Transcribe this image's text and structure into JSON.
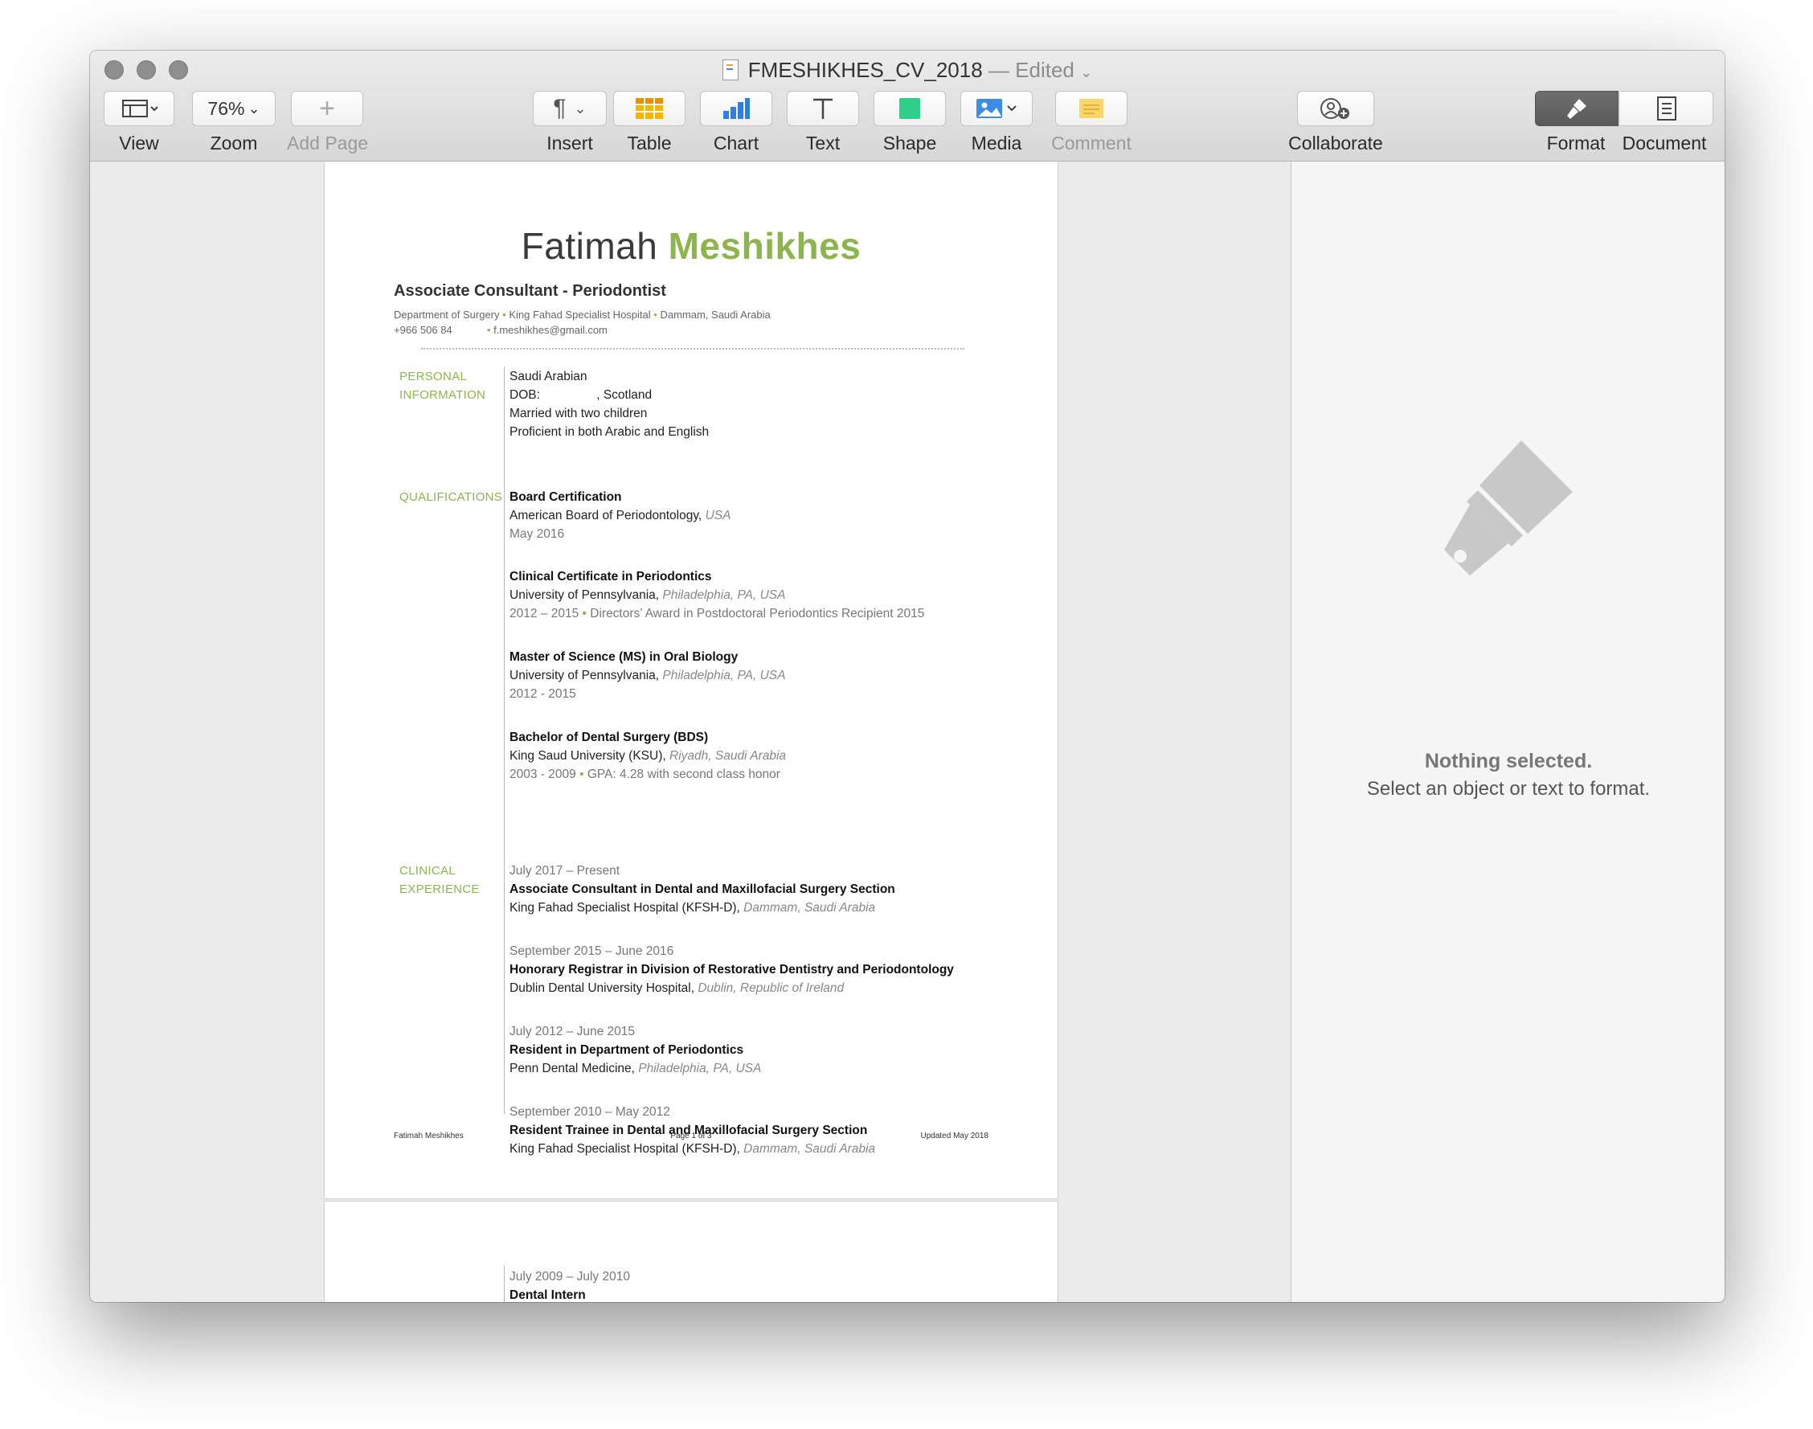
{
  "window": {
    "title": "FMESHIKHES_CV_2018",
    "title_separator": "—",
    "edited": "Edited"
  },
  "toolbar": {
    "view": "View",
    "zoom_value": "76%",
    "zoom": "Zoom",
    "add_page": "Add Page",
    "insert": "Insert",
    "table": "Table",
    "chart": "Chart",
    "text": "Text",
    "shape": "Shape",
    "media": "Media",
    "comment": "Comment",
    "collaborate": "Collaborate",
    "format": "Format",
    "document": "Document"
  },
  "cv": {
    "first_name": "Fatimah",
    "last_name": "Meshikhes",
    "subtitle": "Associate Consultant - Periodontist",
    "contact_line1": {
      "dept": "Department of Surgery",
      "hospital": "King Fahad Specialist Hospital",
      "location": "Dammam, Saudi Arabia"
    },
    "contact_line2": {
      "phone": "+966 506 84",
      "email": "f.meshikhes@gmail.com"
    },
    "personal": {
      "label1": "PERSONAL",
      "label2": "INFORMATION",
      "lines": [
        "Saudi Arabian",
        "DOB: ",
        ", Scotland",
        "Married with two children",
        "Proficient in both Arabic and English"
      ]
    },
    "qualifications": {
      "label": "QUALIFICATIONS",
      "items": [
        {
          "title": "Board Certification",
          "org": "American Board of Periodontology,",
          "place": "USA",
          "date": "May 2016",
          "note": ""
        },
        {
          "title": "Clinical Certificate in Periodontics",
          "org": "University of Pennsylvania,",
          "place": "Philadelphia, PA, USA",
          "date": "2012 – 2015",
          "note": "Directors’ Award in Postdoctoral Periodontics Recipient 2015"
        },
        {
          "title": "Master of Science (MS) in Oral Biology",
          "org": "University of Pennsylvania,",
          "place": "Philadelphia, PA, USA",
          "date": "2012 - 2015",
          "note": ""
        },
        {
          "title": "Bachelor of Dental Surgery (BDS)",
          "org": "King Saud University (KSU),",
          "place": "Riyadh, Saudi Arabia",
          "date": "2003 - 2009",
          "note": "GPA: 4.28 with second class honor"
        }
      ]
    },
    "experience": {
      "label1": "CLINICAL",
      "label2": "EXPERIENCE",
      "items": [
        {
          "date": "July 2017 – Present",
          "title": "Associate Consultant in Dental and Maxillofacial Surgery Section",
          "org": "King Fahad Specialist Hospital (KFSH-D),",
          "place": "Dammam, Saudi Arabia"
        },
        {
          "date": "September 2015 – June 2016",
          "title": "Honorary Registrar in Division of Restorative Dentistry and Periodontology",
          "org": "Dublin Dental University Hospital,",
          "place": "Dublin, Republic of Ireland"
        },
        {
          "date": "July 2012 – June 2015",
          "title": "Resident in Department of Periodontics",
          "org": "Penn Dental Medicine,",
          "place": "Philadelphia, PA, USA"
        },
        {
          "date": "September 2010 – May 2012",
          "title": "Resident Trainee in Dental and Maxillofacial Surgery Section",
          "org": "King Fahad Specialist Hospital (KFSH-D),",
          "place": "Dammam, Saudi Arabia"
        }
      ]
    },
    "footer": {
      "left": "Fatimah Meshikhes",
      "center": "Page 1 of 3",
      "right": "Updated May 2018"
    },
    "page2": {
      "date": "July 2009 – July 2010",
      "title": "Dental Intern"
    }
  },
  "sidebar": {
    "nothing_selected": "Nothing selected.",
    "hint": "Select an object or text to format."
  },
  "colors": {
    "accent_green": "#8db54e"
  }
}
